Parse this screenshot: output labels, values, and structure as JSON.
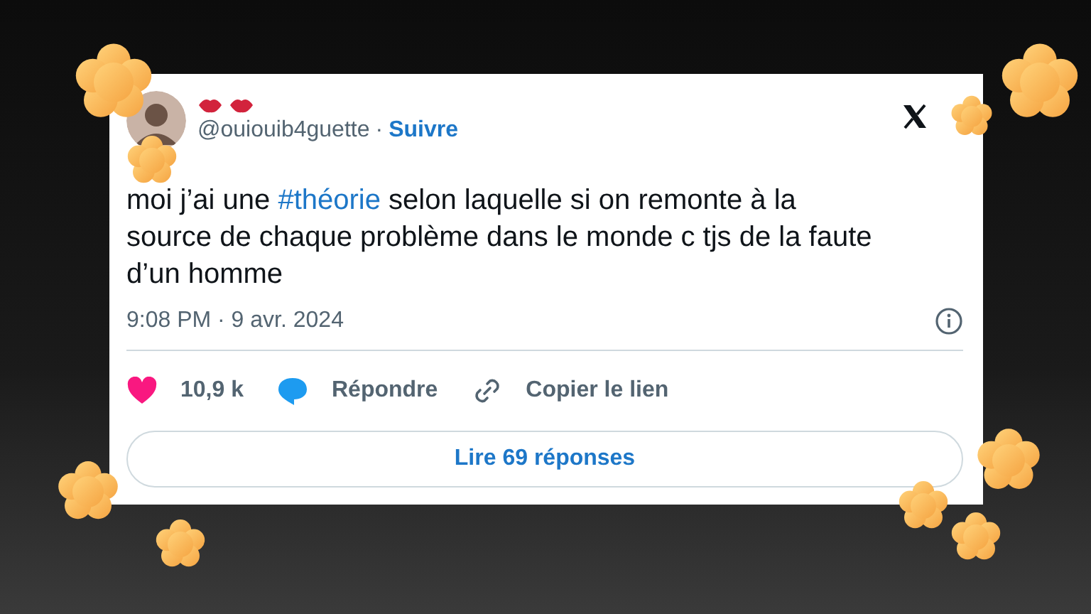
{
  "tweet": {
    "handle": "@ouiouib4guette",
    "separator": "·",
    "follow": "Suivre",
    "text": [
      {
        "kind": "plain",
        "text": "moi j’ai une "
      },
      {
        "kind": "hashtag",
        "text": "#théorie"
      },
      {
        "kind": "plain",
        "text": " selon laquelle si on remonte à la source de chaque problème dans le monde c tjs de la faute d’un homme"
      }
    ],
    "timestamp": "9:08 PM · 9 avr. 2024",
    "actions": [
      {
        "kind": "like",
        "label": "10,9 k"
      },
      {
        "kind": "reply",
        "label": "Répondre"
      },
      {
        "kind": "link",
        "label": "Copier le lien"
      }
    ],
    "read_replies": "Lire 69 réponses"
  }
}
